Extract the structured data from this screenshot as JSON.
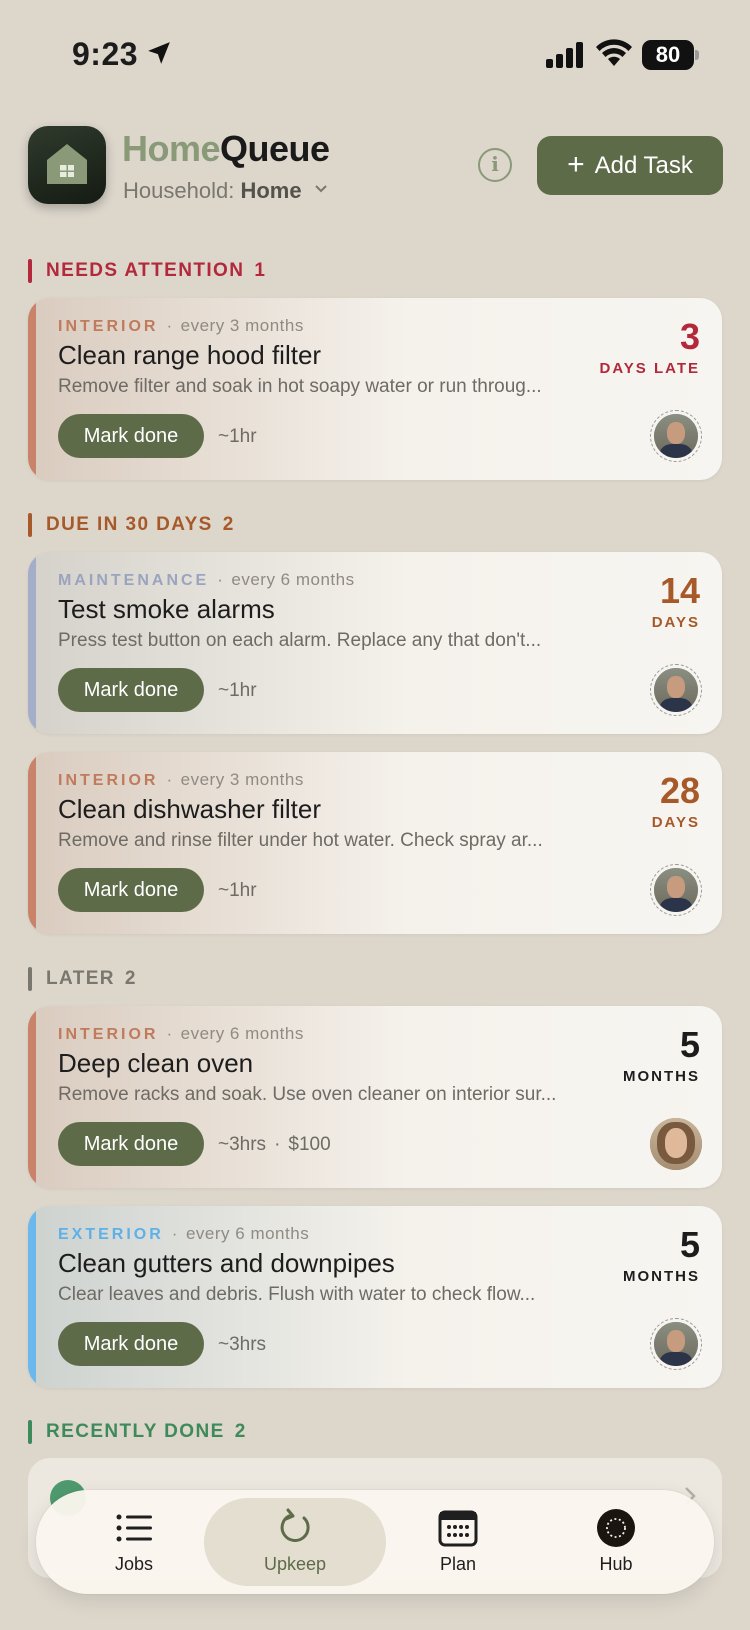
{
  "status_bar": {
    "time": "9:23",
    "battery": "80"
  },
  "header": {
    "brand_part1": "Home",
    "brand_part2": "Queue",
    "household_label": "Household:",
    "household_value": "Home",
    "info_label": "i",
    "add_task_label": "Add Task"
  },
  "sections": {
    "needs_attention": {
      "label": "NEEDS ATTENTION",
      "count": "1",
      "color": "#b3283a"
    },
    "due_30": {
      "label": "DUE IN 30 DAYS",
      "count": "2",
      "color": "#a8592a"
    },
    "later": {
      "label": "LATER",
      "count": "2",
      "color": "#7a776f"
    },
    "recently_done": {
      "label": "RECENTLY DONE",
      "count": "2",
      "color": "#3f8a5a"
    }
  },
  "cards": [
    {
      "category": "INTERIOR",
      "frequency": "every 3 months",
      "title": "Clean range hood filter",
      "description": "Remove filter and soak in hot soapy water or run throug...",
      "action": "Mark done",
      "effort": "~1hr",
      "cost": "",
      "due_value": "3",
      "due_unit": "DAYS LATE",
      "accent": "#c9836a",
      "category_color": "#c07a5c",
      "due_color": "#b3283a"
    },
    {
      "category": "MAINTENANCE",
      "frequency": "every 6 months",
      "title": "Test smoke alarms",
      "description": "Press test button on each alarm. Replace any that don't...",
      "action": "Mark done",
      "effort": "~1hr",
      "cost": "",
      "due_value": "14",
      "due_unit": "DAYS",
      "accent": "#a4aec8",
      "category_color": "#9aa4be",
      "due_color": "#a8592a"
    },
    {
      "category": "INTERIOR",
      "frequency": "every 3 months",
      "title": "Clean dishwasher filter",
      "description": "Remove and rinse filter under hot water. Check spray ar...",
      "action": "Mark done",
      "effort": "~1hr",
      "cost": "",
      "due_value": "28",
      "due_unit": "DAYS",
      "accent": "#c9836a",
      "category_color": "#c07a5c",
      "due_color": "#a8592a"
    },
    {
      "category": "INTERIOR",
      "frequency": "every 6 months",
      "title": "Deep clean oven",
      "description": "Remove racks and soak. Use oven cleaner on interior sur...",
      "action": "Mark done",
      "effort": "~3hrs",
      "cost": "$100",
      "due_value": "5",
      "due_unit": "MONTHS",
      "accent": "#c9836a",
      "category_color": "#c07a5c",
      "due_color": "#1c1c1c"
    },
    {
      "category": "EXTERIOR",
      "frequency": "every 6 months",
      "title": "Clean gutters and downpipes",
      "description": "Clear leaves and debris. Flush with water to check flow...",
      "action": "Mark done",
      "effort": "~3hrs",
      "cost": "",
      "due_value": "5",
      "due_unit": "MONTHS",
      "accent": "#6bb8ec",
      "category_color": "#5fb0e6",
      "due_color": "#1c1c1c"
    }
  ],
  "tabs": [
    {
      "label": "Jobs",
      "icon": "list-icon"
    },
    {
      "label": "Upkeep",
      "icon": "refresh-icon"
    },
    {
      "label": "Plan",
      "icon": "calendar-icon"
    },
    {
      "label": "Hub",
      "icon": "hub-icon"
    }
  ]
}
